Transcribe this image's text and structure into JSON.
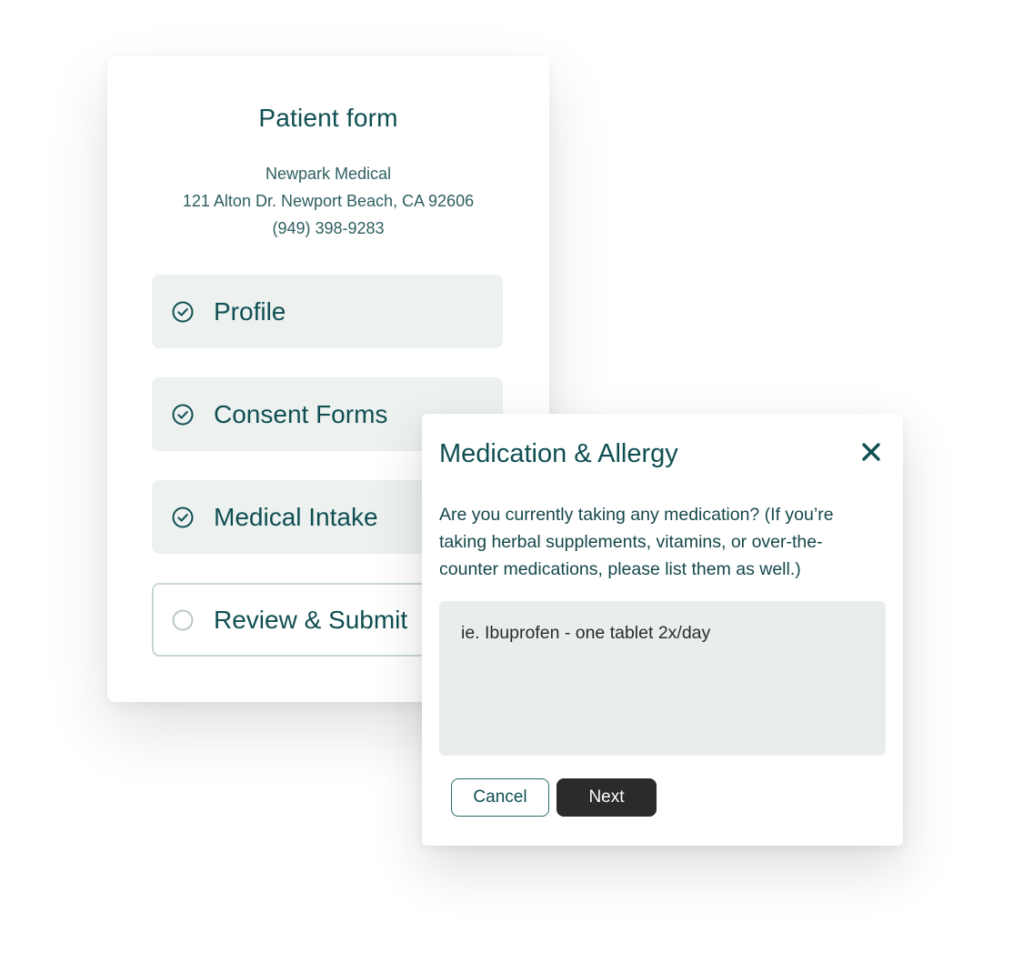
{
  "patient_form": {
    "title": "Patient form",
    "clinic": {
      "name": "Newpark Medical",
      "address": "121 Alton Dr. Newport Beach, CA 92606",
      "phone": "(949) 398-9283"
    },
    "steps": [
      {
        "label": "Profile",
        "status": "complete",
        "icon": "check-circle-icon"
      },
      {
        "label": "Consent Forms",
        "status": "complete",
        "icon": "check-circle-icon"
      },
      {
        "label": "Medical Intake",
        "status": "complete",
        "icon": "check-circle-icon"
      },
      {
        "label": "Review & Submit",
        "status": "pending",
        "icon": "empty-circle-icon"
      }
    ]
  },
  "dialog": {
    "title": "Medication & Allergy",
    "close_icon": "close-icon",
    "question_lines": [
      "Are you currently taking any medication? (If you’re",
      "taking herbal supplements, vitamins, or over-the-",
      "counter medications, please list them as well.)"
    ],
    "input": {
      "value": "",
      "placeholder": "ie. Ibuprofen - one tablet 2x/day"
    },
    "cancel_label": "Cancel",
    "next_label": "Next"
  },
  "colors": {
    "primary_text": "#0f4f52",
    "step_background": "#edf1f0",
    "input_background": "#e9eeed",
    "next_button": "#2b2b2b"
  }
}
